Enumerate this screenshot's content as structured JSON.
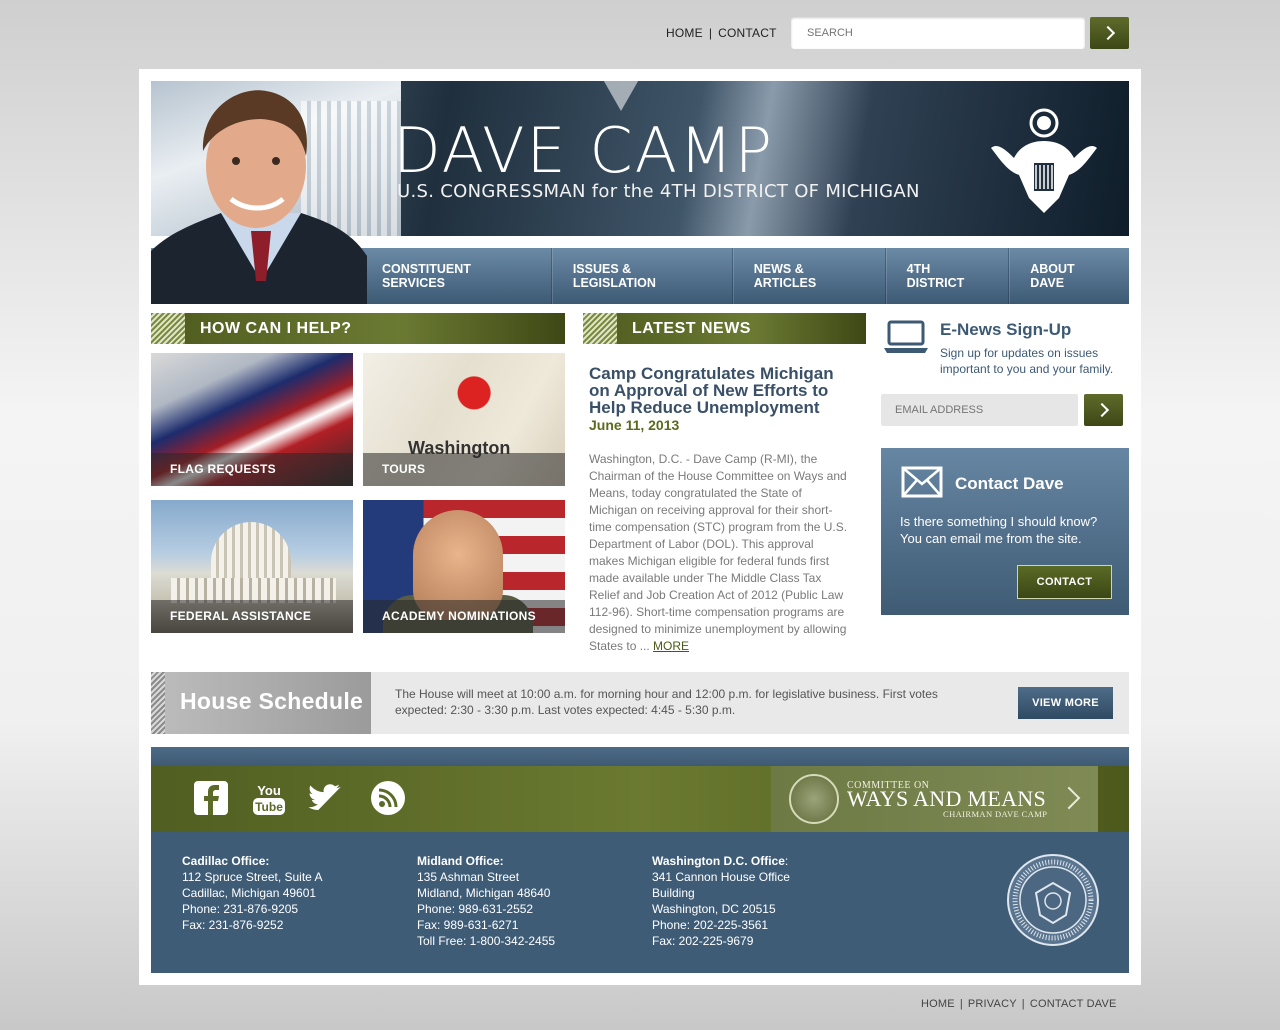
{
  "top_nav": {
    "home": "HOME",
    "sep": "|",
    "contact": "CONTACT"
  },
  "search": {
    "placeholder": "SEARCH"
  },
  "banner": {
    "name": "DAVE CAMP",
    "subtitle": "U.S. CONGRESSMAN for the 4TH DISTRICT OF MICHIGAN"
  },
  "main_nav": [
    "CONSTITUENT SERVICES",
    "ISSUES & LEGISLATION",
    "NEWS & ARTICLES",
    "4TH DISTRICT",
    "ABOUT DAVE"
  ],
  "help": {
    "title": "HOW CAN I HELP?",
    "tiles": [
      "FLAG REQUESTS",
      "TOURS",
      "FEDERAL ASSISTANCE",
      "ACADEMY NOMINATIONS"
    ],
    "tours_map_word": "Washington"
  },
  "news": {
    "title": "LATEST NEWS",
    "headline": "Camp Congratulates Michigan on Approval of New Efforts to Help Reduce Unemployment",
    "date": "June 11, 2013",
    "body": "Washington, D.C. - Dave Camp (R-MI), the Chairman of the House Committee on Ways and Means, today congratulated the State of Michigan on receiving approval for their short-time compensation (STC) program from the U.S. Department of Labor (DOL). This approval makes Michigan eligible for federal funds first made available under The Middle Class Tax Relief and Job Creation Act of 2012 (Public Law 112-96). Short-time compensation programs are designed to minimize unemployment by allowing States to ...",
    "more": "MORE"
  },
  "enews": {
    "title": "E-News Sign-Up",
    "description": "Sign up for updates on issues important to you and your family.",
    "placeholder": "EMAIL ADDRESS"
  },
  "contact_box": {
    "title": "Contact Dave",
    "text": "Is there something I should know? You can email me from the site.",
    "button": "CONTACT"
  },
  "schedule": {
    "label": "House Schedule",
    "text": "The House will meet at 10:00 a.m. for morning hour and 12:00 p.m. for legislative business. First votes expected: 2:30 - 3:30 p.m. Last votes expected: 4:45 - 5:30 p.m.",
    "button": "VIEW MORE"
  },
  "ways_means": {
    "line1": "COMMITTEE ON",
    "line2": "WAYS AND MEANS",
    "line3": "CHAIRMAN DAVE CAMP"
  },
  "offices": [
    {
      "name": "Cadillac Office:",
      "lines": [
        "112 Spruce Street, Suite A",
        "Cadillac, Michigan 49601",
        "Phone: 231-876-9205",
        "Fax: 231-876-9252"
      ]
    },
    {
      "name": "Midland Office:",
      "lines": [
        "135 Ashman Street",
        "Midland, Michigan 48640",
        "Phone: 989-631-2552",
        "Fax: 989-631-6271",
        "Toll Free: 1-800-342-2455"
      ]
    },
    {
      "name": "Washington D.C. Office",
      "lines": [
        "341 Cannon House Office",
        "Building",
        "Washington, DC 20515",
        "Phone: 202-225-3561",
        "Fax: 202-225-9679"
      ]
    }
  ],
  "bottom_nav": {
    "home": "HOME",
    "privacy": "PRIVACY",
    "contact": "CONTACT DAVE",
    "sep": "|"
  },
  "icons": {
    "social": [
      "facebook-icon",
      "youtube-icon",
      "twitter-icon",
      "rss-icon"
    ],
    "colors": {
      "olive": "#5a6a25",
      "steel_blue": "#3f5c77",
      "headline_blue": "#3a5068"
    }
  }
}
